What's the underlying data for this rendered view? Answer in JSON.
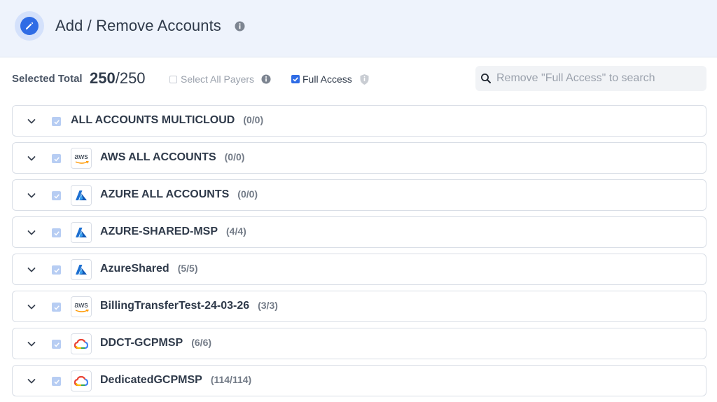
{
  "header": {
    "title": "Add / Remove Accounts",
    "icon": "pencil-icon",
    "info_icon": "info-icon"
  },
  "toolbar": {
    "selected_label": "Selected Total",
    "selected_count": "250",
    "selected_total": "/250",
    "select_all_payers_label": "Select All Payers",
    "select_all_payers_checked": false,
    "full_access_label": "Full Access",
    "full_access_checked": true
  },
  "search": {
    "placeholder": "Remove \"Full Access\" to search"
  },
  "colors": {
    "accent": "#2f6ce5",
    "header_bg": "#eef3fc",
    "checkbox_disabled": "#b7cdf3"
  },
  "accounts": [
    {
      "name": "ALL ACCOUNTS MULTICLOUD",
      "count": "(0/0)",
      "provider": "none"
    },
    {
      "name": "AWS ALL ACCOUNTS",
      "count": "(0/0)",
      "provider": "aws",
      "logo_text": "aws"
    },
    {
      "name": "AZURE ALL ACCOUNTS",
      "count": "(0/0)",
      "provider": "azure"
    },
    {
      "name": "AZURE-SHARED-MSP",
      "count": "(4/4)",
      "provider": "azure"
    },
    {
      "name": "AzureShared",
      "count": "(5/5)",
      "provider": "azure"
    },
    {
      "name": "BillingTransferTest-24-03-26",
      "count": "(3/3)",
      "provider": "aws",
      "logo_text": "aws"
    },
    {
      "name": "DDCT-GCPMSP",
      "count": "(6/6)",
      "provider": "gcp"
    },
    {
      "name": "DedicatedGCPMSP",
      "count": "(114/114)",
      "provider": "gcp"
    }
  ]
}
